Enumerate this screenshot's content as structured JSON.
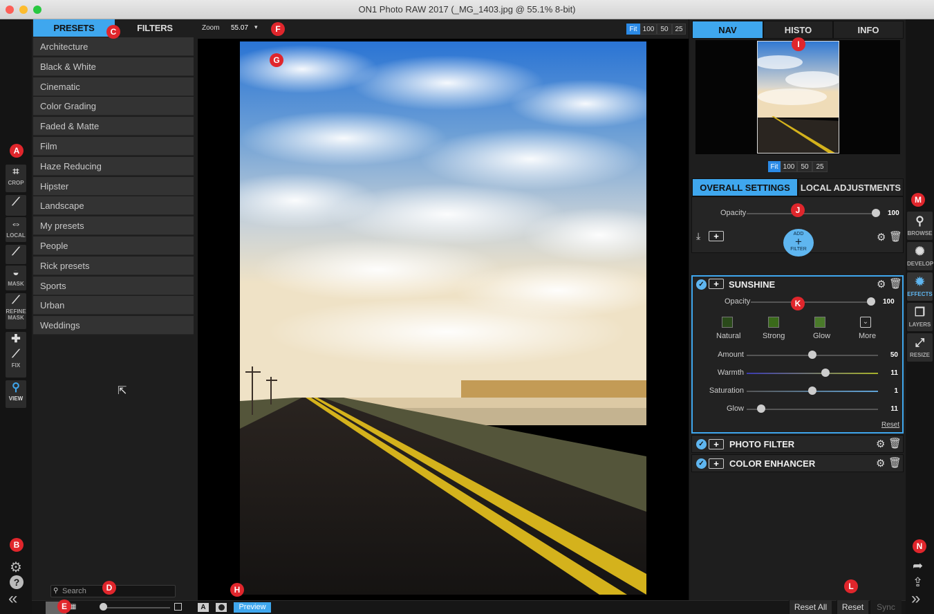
{
  "window": {
    "title": "ON1 Photo RAW 2017 (_MG_1403.jpg @ 55.1% 8-bit)"
  },
  "left_tools": [
    {
      "label": "CROP",
      "icon": "crop-icon"
    },
    {
      "label": "",
      "icon": "brush-icon"
    },
    {
      "label": "LOCAL",
      "icon": "local-adjust-icon"
    },
    {
      "label": "",
      "icon": "brush-mask-icon"
    },
    {
      "label": "MASK",
      "icon": "mask-icon"
    },
    {
      "label": "REFINE\nMASK",
      "icon": "refine-mask-icon"
    },
    {
      "label": "",
      "icon": "bandage-icon"
    },
    {
      "label": "FIX",
      "icon": "fix-icon"
    },
    {
      "label": "VIEW",
      "icon": "magnifier-icon"
    }
  ],
  "presets_panel": {
    "tabs": [
      "PRESETS",
      "FILTERS"
    ],
    "active_tab": "PRESETS",
    "categories": [
      "Architecture",
      "Black & White",
      "Cinematic",
      "Color Grading",
      "Faded & Matte",
      "Film",
      "Haze Reducing",
      "Hipster",
      "Landscape",
      "My presets",
      "People",
      "Rick presets",
      "Sports",
      "Urban",
      "Weddings"
    ],
    "search_placeholder": "Search"
  },
  "canvas": {
    "zoom_label": "Zoom",
    "zoom_value": "55.07",
    "zoom_buttons": [
      "Fit",
      "100",
      "50",
      "25"
    ],
    "active_zoom": "Fit"
  },
  "right_panel": {
    "nav_tabs": [
      "NAV",
      "HISTO",
      "INFO"
    ],
    "active_nav_tab": "NAV",
    "nav_zoom_buttons": [
      "Fit",
      "100",
      "50",
      "25"
    ],
    "settings_tabs": [
      "OVERALL SETTINGS",
      "LOCAL ADJUSTMENTS"
    ],
    "active_settings_tab": "OVERALL SETTINGS",
    "overall_opacity_label": "Opacity",
    "overall_opacity_value": "100",
    "add_filter_top": "ADD",
    "add_filter_plus": "+",
    "add_filter_bottom": "FILTER",
    "filters": [
      {
        "name": "SUNSHINE",
        "expanded": true,
        "opacity_label": "Opacity",
        "opacity_value": "100",
        "presets": [
          "Natural",
          "Strong",
          "Glow",
          "More"
        ],
        "sliders": [
          {
            "label": "Amount",
            "value": "50",
            "fraction": 0.5
          },
          {
            "label": "Warmth",
            "value": "11",
            "fraction": 0.6
          },
          {
            "label": "Saturation",
            "value": "1",
            "fraction": 0.5
          },
          {
            "label": "Glow",
            "value": "11",
            "fraction": 0.11
          }
        ],
        "reset_label": "Reset"
      },
      {
        "name": "PHOTO FILTER",
        "expanded": false
      },
      {
        "name": "COLOR ENHANCER",
        "expanded": false
      }
    ]
  },
  "modules": [
    {
      "label": "BROWSE",
      "icon": "browse-icon"
    },
    {
      "label": "DEVELOP",
      "icon": "aperture-icon"
    },
    {
      "label": "EFFECTS",
      "icon": "effects-icon"
    },
    {
      "label": "LAYERS",
      "icon": "layers-icon"
    },
    {
      "label": "RESIZE",
      "icon": "resize-icon"
    }
  ],
  "active_module": "EFFECTS",
  "bottom_bar": {
    "preview_label": "Preview",
    "reset_all_label": "Reset All",
    "reset_label": "Reset",
    "sync_label": "Sync"
  },
  "callouts": [
    "A",
    "B",
    "C",
    "D",
    "E",
    "F",
    "G",
    "H",
    "I",
    "J",
    "K",
    "L",
    "M",
    "N"
  ],
  "colors": {
    "accent": "#3fa7ee",
    "callout": "#e0262c"
  }
}
